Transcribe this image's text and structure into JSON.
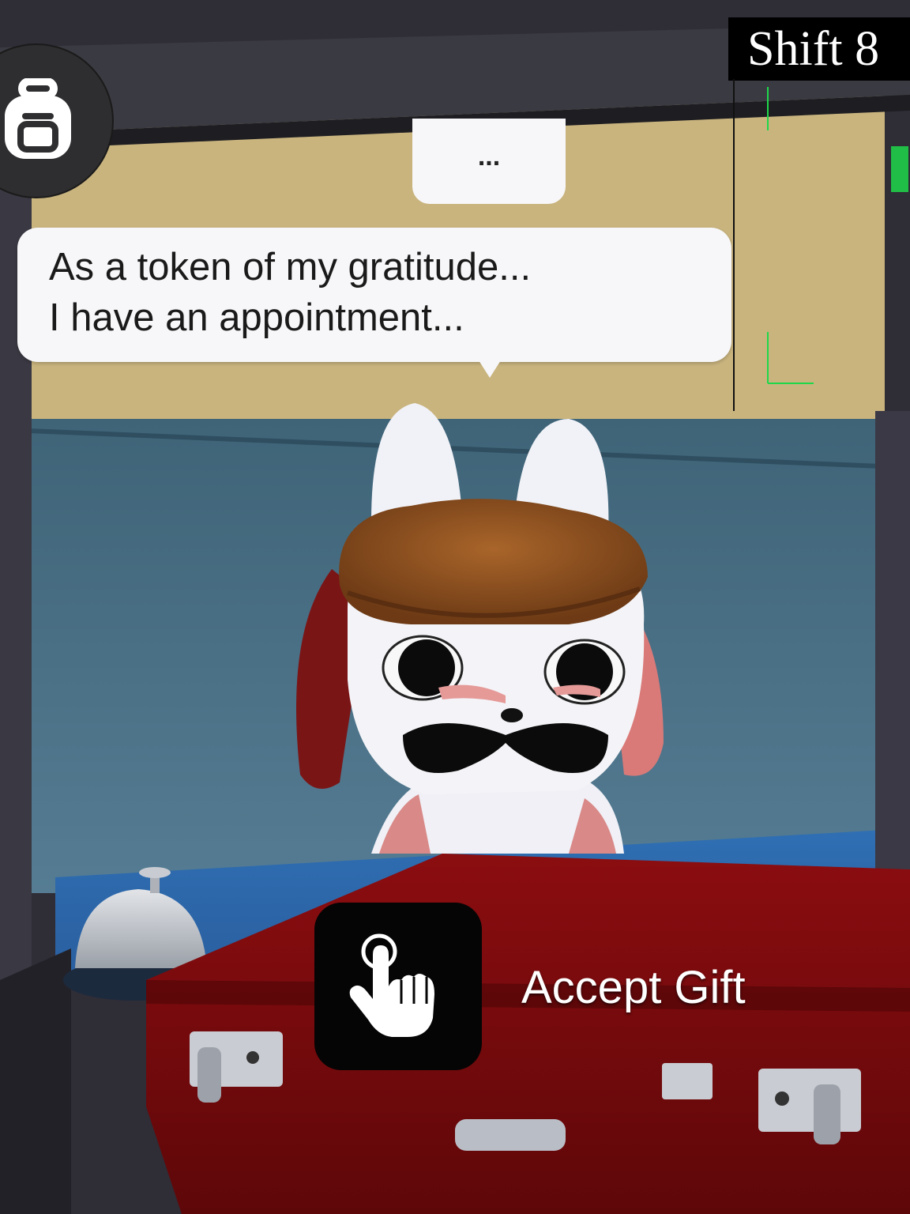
{
  "hud": {
    "shift_label": "Shift 8",
    "backpack_icon": "backpack-icon"
  },
  "dialogue": {
    "thinking": "...",
    "lines": [
      "As a token of my gratitude...",
      "I have an appointment..."
    ]
  },
  "interaction": {
    "prompt_icon": "tap-hand-icon",
    "action_label": "Accept Gift"
  },
  "colors": {
    "briefcase": "#7a0a0c",
    "monitor_green": "#1fd84a",
    "wall_blue": "#4a6f86",
    "wall_tan": "#c8b37f"
  }
}
